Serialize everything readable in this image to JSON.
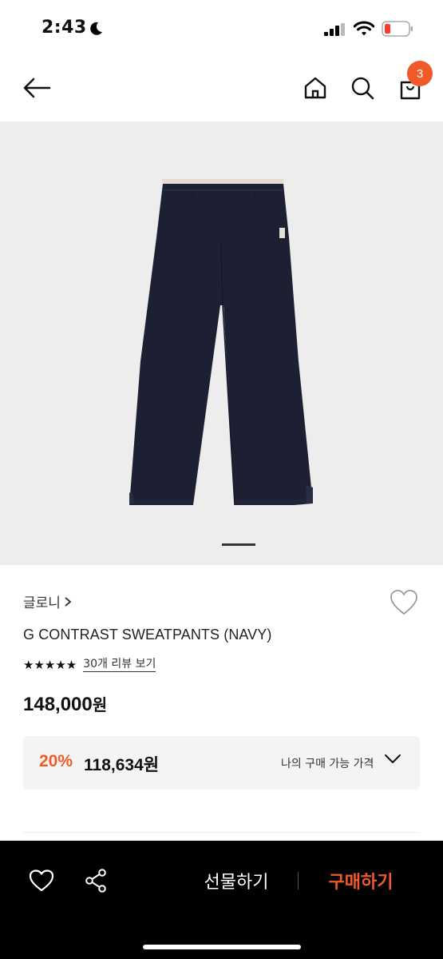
{
  "status_bar": {
    "time": "2:43"
  },
  "nav": {
    "cart_badge_count": "3"
  },
  "product": {
    "brand": "글로니",
    "name": "G CONTRAST SWEATPANTS (NAVY)",
    "stars": "★★★★★",
    "review_link": "30개 리뷰 보기",
    "price": "148,000",
    "currency": "원",
    "discount_rate": "20%",
    "discount_price": "118,634원",
    "my_price_label": "나의 구매 가능 가격"
  },
  "bottom_bar": {
    "gift_label": "선물하기",
    "buy_label": "구매하기"
  },
  "colors": {
    "accent": "#f05a28",
    "pants_navy": "#1d1f33",
    "image_bg": "#ededee"
  }
}
